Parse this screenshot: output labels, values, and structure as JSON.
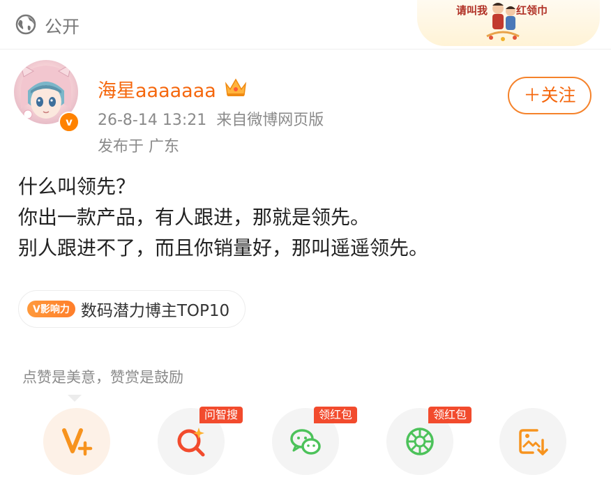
{
  "header": {
    "visibility_label": "公开",
    "visibility_icon": "globe-icon",
    "banner": {
      "left_text": "请叫我",
      "right_text": "红领巾"
    }
  },
  "author": {
    "name": "海星aaaaaaa",
    "verified_icon": "verified-v-icon",
    "member_icon": "crown-icon",
    "timestamp": "26-8-14 13:21",
    "source": "来自微博网页版",
    "location": "发布于 广东",
    "follow_label": "＋关注"
  },
  "post": {
    "lines": [
      "什么叫领先？",
      "你出一款产品，有人跟进，那就是领先。",
      "别人跟进不了，而且你销量好，那叫遥遥领先。"
    ]
  },
  "influence_tag": {
    "badge": "V影响力",
    "label": "数码潜力博主TOP10"
  },
  "reward": {
    "prompt": "点赞是美意，赞赏是鼓励",
    "actions": [
      {
        "icon": "v-plus-icon",
        "badge": ""
      },
      {
        "icon": "ai-search-icon",
        "badge": "问智搜"
      },
      {
        "icon": "wechat-icon",
        "badge": "领红包"
      },
      {
        "icon": "moments-icon",
        "badge": "领红包"
      },
      {
        "icon": "save-image-icon",
        "badge": ""
      }
    ]
  },
  "colors": {
    "accent": "#f5670d",
    "badge_red": "#f24b2d",
    "wechat_green": "#4cc25a"
  }
}
